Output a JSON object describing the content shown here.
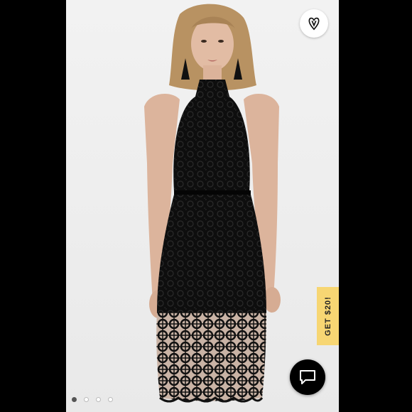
{
  "promo": {
    "label": "GET $20!"
  },
  "carousel": {
    "total": 4,
    "active": 1
  },
  "colors": {
    "promo_bg": "#f7d673",
    "chat_bg": "#000000",
    "dress": "#0d0d0d"
  },
  "icons": {
    "brand": "heart-v-logo-icon",
    "chat": "chat-bubble-icon"
  }
}
